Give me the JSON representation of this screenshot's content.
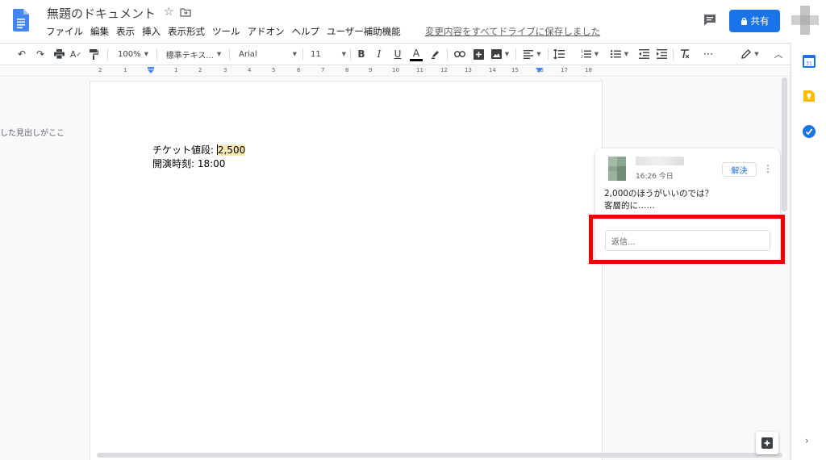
{
  "header": {
    "doc_title": "無題のドキュメント",
    "menu": [
      "ファイル",
      "編集",
      "表示",
      "挿入",
      "表示形式",
      "ツール",
      "アドオン",
      "ヘルプ",
      "ユーザー補助機能"
    ],
    "save_status": "変更内容をすべてドライブに保存しました",
    "share_label": "共有"
  },
  "toolbar": {
    "zoom": "100%",
    "style": "標準テキス...",
    "font": "Arial",
    "font_size": "11",
    "bold": "B",
    "italic": "I",
    "underline": "U",
    "text_color": "A"
  },
  "ruler": {
    "numbers": [
      "2",
      "1",
      "1",
      "2",
      "3",
      "4",
      "5",
      "6",
      "7",
      "8",
      "9",
      "10",
      "11",
      "12",
      "13",
      "14",
      "15",
      "16",
      "17",
      "18"
    ]
  },
  "outline": {
    "text": "した見出しがここ"
  },
  "document": {
    "line1_label": "チケット値段: ",
    "line1_value": "2,500",
    "line2": "開演時刻: 18:00"
  },
  "comment": {
    "time": "16:26 今日",
    "resolve_label": "解決",
    "body_line1": "2,000のほうがいいのでは？",
    "body_line2": "客層的に……",
    "reply_placeholder": "返信..."
  },
  "colors": {
    "accent": "#1a73e8",
    "highlight": "#fce8b2",
    "annotation": "#ee0000"
  }
}
